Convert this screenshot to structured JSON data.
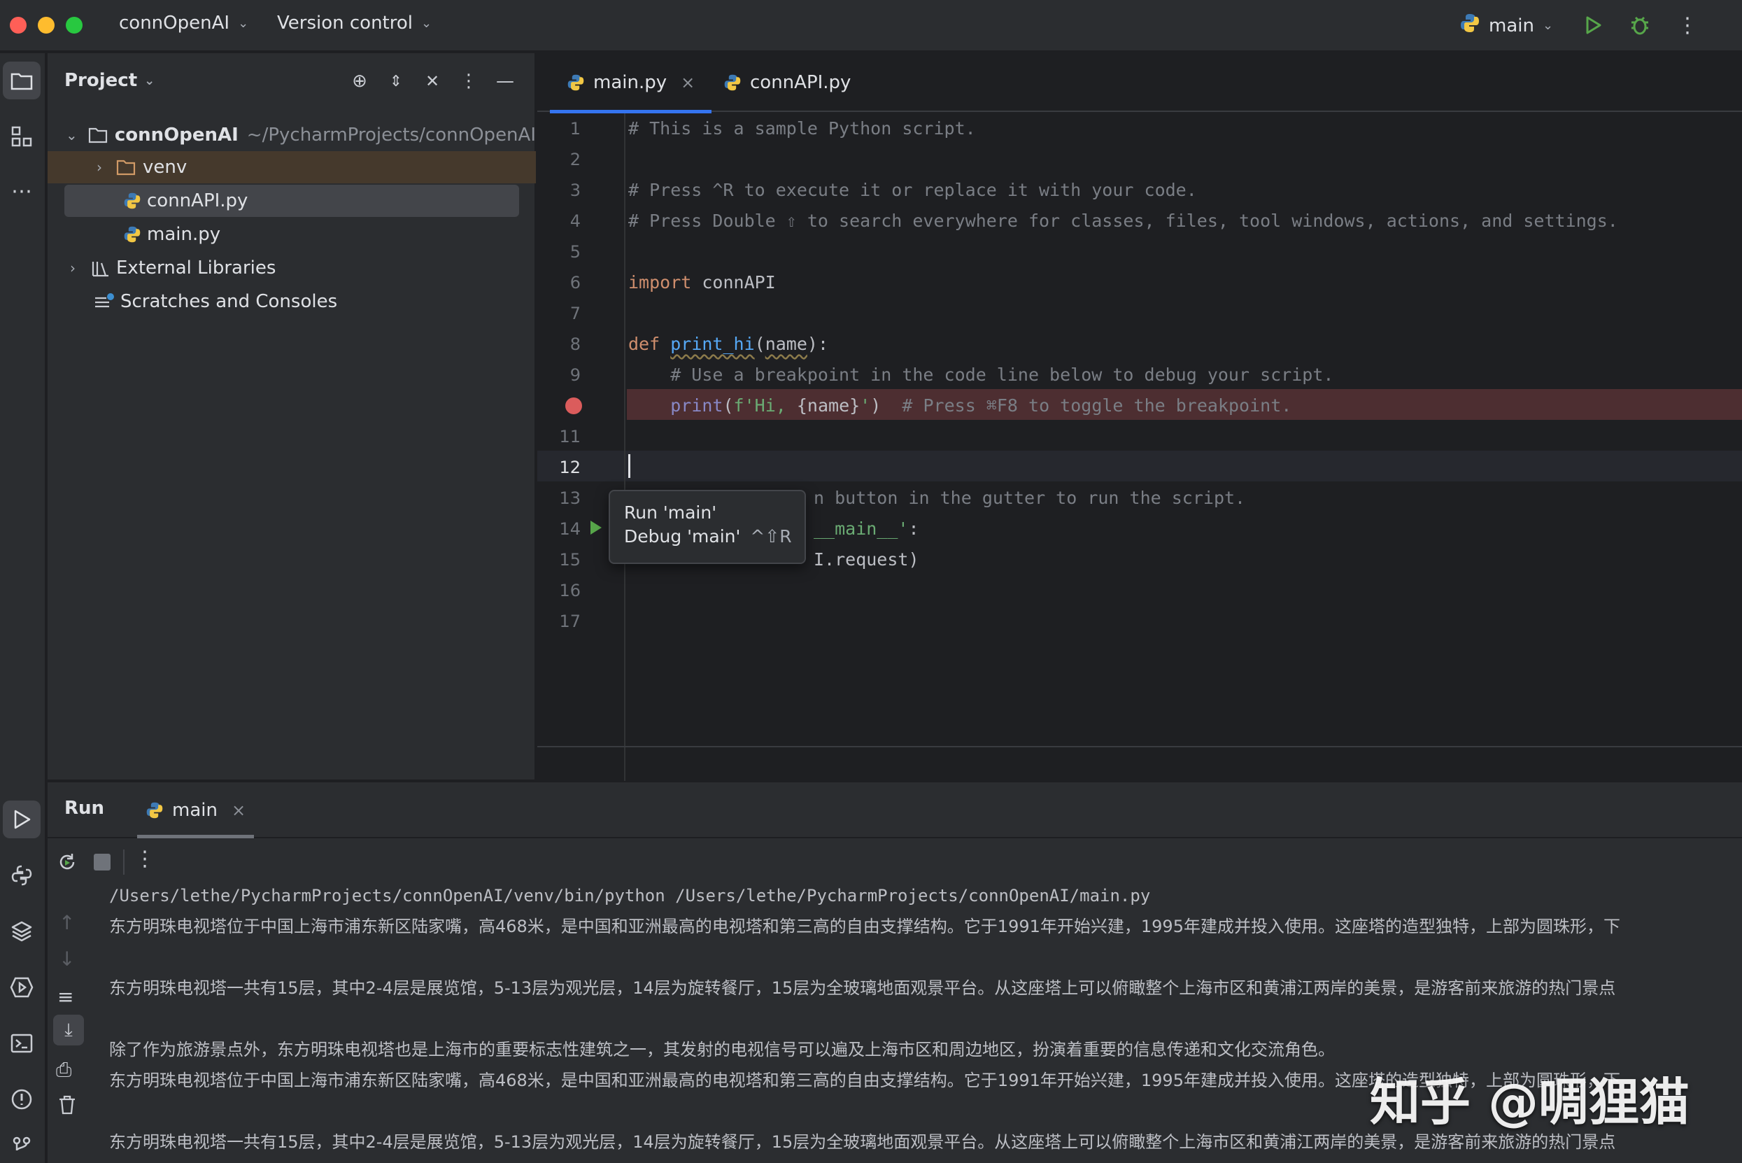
{
  "titlebar": {
    "project_name": "connOpenAI",
    "vcs_label": "Version control",
    "run_config": "main",
    "colors": {
      "close": "#ff5f57",
      "minimize": "#febc2e",
      "zoom": "#28c840"
    }
  },
  "project_panel": {
    "title": "Project",
    "tree": {
      "root_name": "connOpenAI",
      "root_path": "~/PycharmProjects/connOpenAI",
      "venv": "venv",
      "file1": "connAPI.py",
      "file2": "main.py",
      "ext_libs": "External Libraries",
      "scratches": "Scratches and Consoles"
    }
  },
  "editor": {
    "tabs": [
      {
        "label": "main.py"
      },
      {
        "label": "connAPI.py"
      }
    ],
    "line_numbers": [
      "1",
      "2",
      "3",
      "4",
      "5",
      "6",
      "7",
      "8",
      "9",
      "",
      "11",
      "12",
      "13",
      "14",
      "15",
      "16",
      "17"
    ],
    "code": {
      "l1": "# This is a sample Python script.",
      "l3": "# Press ^R to execute it or replace it with your code.",
      "l4": "# Press Double ⇧ to search everywhere for classes, files, tool windows, actions, and settings.",
      "l6_kw": "import",
      "l6_rest": " connAPI",
      "l8_kw": "def",
      "l8_fn": "print_hi",
      "l8_open": "(",
      "l8_param": "name",
      "l8_close": "):",
      "l9": "    # Use a breakpoint in the code line below to debug your script.",
      "l10_builtin": "print",
      "l10_open": "(",
      "l10_str1": "f'Hi, ",
      "l10_var": "{name}",
      "l10_str2": "'",
      "l10_close": ")",
      "l10_cmt": "  # Press ⌘F8 to toggle the breakpoint.",
      "l13": "n button in the gutter to run the script.",
      "l14": "__main__':",
      "l14_str": "__main__'",
      "l14_colon": ":",
      "l15": "I.request)"
    },
    "tooltip": {
      "run": "Run 'main'",
      "debug": "Debug 'main'",
      "debug_shortcut": "^⇧R"
    }
  },
  "run_panel": {
    "title": "Run",
    "tab_label": "main",
    "console_lines": [
      "/Users/lethe/PycharmProjects/connOpenAI/venv/bin/python /Users/lethe/PycharmProjects/connOpenAI/main.py",
      "东方明珠电视塔位于中国上海市浦东新区陆家嘴，高468米，是中国和亚洲最高的电视塔和第三高的自由支撑结构。它于1991年开始兴建，1995年建成并投入使用。这座塔的造型独特，上部为圆珠形，下",
      "",
      "东方明珠电视塔一共有15层，其中2-4层是展览馆，5-13层为观光层，14层为旋转餐厅，15层为全玻璃地面观景平台。从这座塔上可以俯瞰整个上海市区和黄浦江两岸的美景，是游客前来旅游的热门景点",
      "",
      "除了作为旅游景点外，东方明珠电视塔也是上海市的重要标志性建筑之一，其发射的电视信号可以遍及上海市区和周边地区，扮演着重要的信息传递和文化交流角色。",
      "东方明珠电视塔位于中国上海市浦东新区陆家嘴，高468米，是中国和亚洲最高的电视塔和第三高的自由支撑结构。它于1991年开始兴建，1995年建成并投入使用。这座塔的造型独特，上部为圆珠形，下",
      "",
      "东方明珠电视塔一共有15层，其中2-4层是展览馆，5-13层为观光层，14层为旋转餐厅，15层为全玻璃地面观景平台。从这座塔上可以俯瞰整个上海市区和黄浦江两岸的美景，是游客前来旅游的热门景点"
    ]
  },
  "watermark": "知乎 @啁狸猫"
}
